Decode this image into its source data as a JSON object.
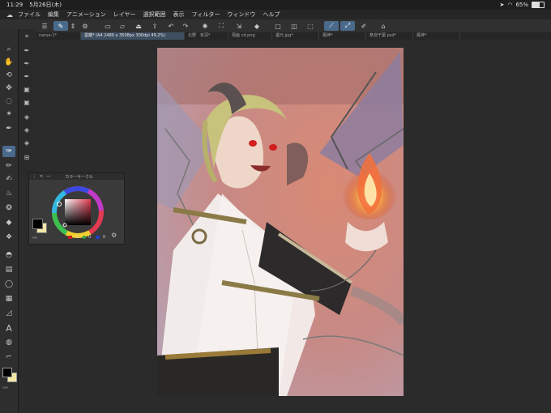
{
  "status": {
    "time": "11:29",
    "date": "5月26日(木)",
    "battery_text": "65%",
    "battery_level": 0.65
  },
  "menu": [
    "ファイル",
    "編集",
    "アニメーション",
    "レイヤー",
    "選択範囲",
    "表示",
    "フィルター",
    "ウィンドウ",
    "ヘルプ"
  ],
  "tabs": [
    {
      "label": "narue-1*",
      "active": false
    },
    {
      "label": "墨鐵* (A4 2480 x 3508px 300dpi 49.2%)",
      "active": true
    },
    {
      "label": "北野　有羽*",
      "active": false
    },
    {
      "label": "現画 cd.png",
      "active": false
    },
    {
      "label": "遺元.jpg*",
      "active": false
    },
    {
      "label": "鳳神*",
      "active": false
    },
    {
      "label": "祭自干葉.psd*",
      "active": false
    },
    {
      "label": "鳳神*",
      "active": false
    }
  ],
  "color_panel": {
    "title": "カラーサークル",
    "values": [
      "0",
      "0",
      "0"
    ],
    "hue_color": "#e23a50",
    "main_color": "#000000",
    "sub_color": "#f2e8a6"
  },
  "colors": {
    "accent": "#4a6a8c",
    "background": "#2b2b2b"
  },
  "icons": {
    "toolbar": [
      "menu-icon",
      "pen-icon",
      "stepper-icon",
      "layer-settings-icon",
      "new-file-icon",
      "open-folder-icon",
      "save-icon",
      "export-icon",
      "undo-icon",
      "redo-icon",
      "loading-icon",
      "crop-icon",
      "transform-icon",
      "clear-icon",
      "select-all-icon",
      "deselect-icon",
      "snap-ruler-icon",
      "snap-special-ruler-icon",
      "grid-snap-icon",
      "quick-access-icon"
    ],
    "left_tools": [
      "zoom-icon",
      "hand-icon",
      "rotate-icon",
      "move-layer-icon",
      "lasso-icon",
      "magic-wand-icon",
      "eyedropper-icon",
      "pen-tool-icon",
      "pencil-icon",
      "brush-icon",
      "airbrush-icon",
      "decoration-icon",
      "eraser-icon",
      "blend-icon",
      "fill-icon",
      "gradient-icon",
      "figure-icon",
      "frame-icon",
      "ruler-icon",
      "text-icon",
      "balloon-icon",
      "correct-line-icon"
    ]
  }
}
